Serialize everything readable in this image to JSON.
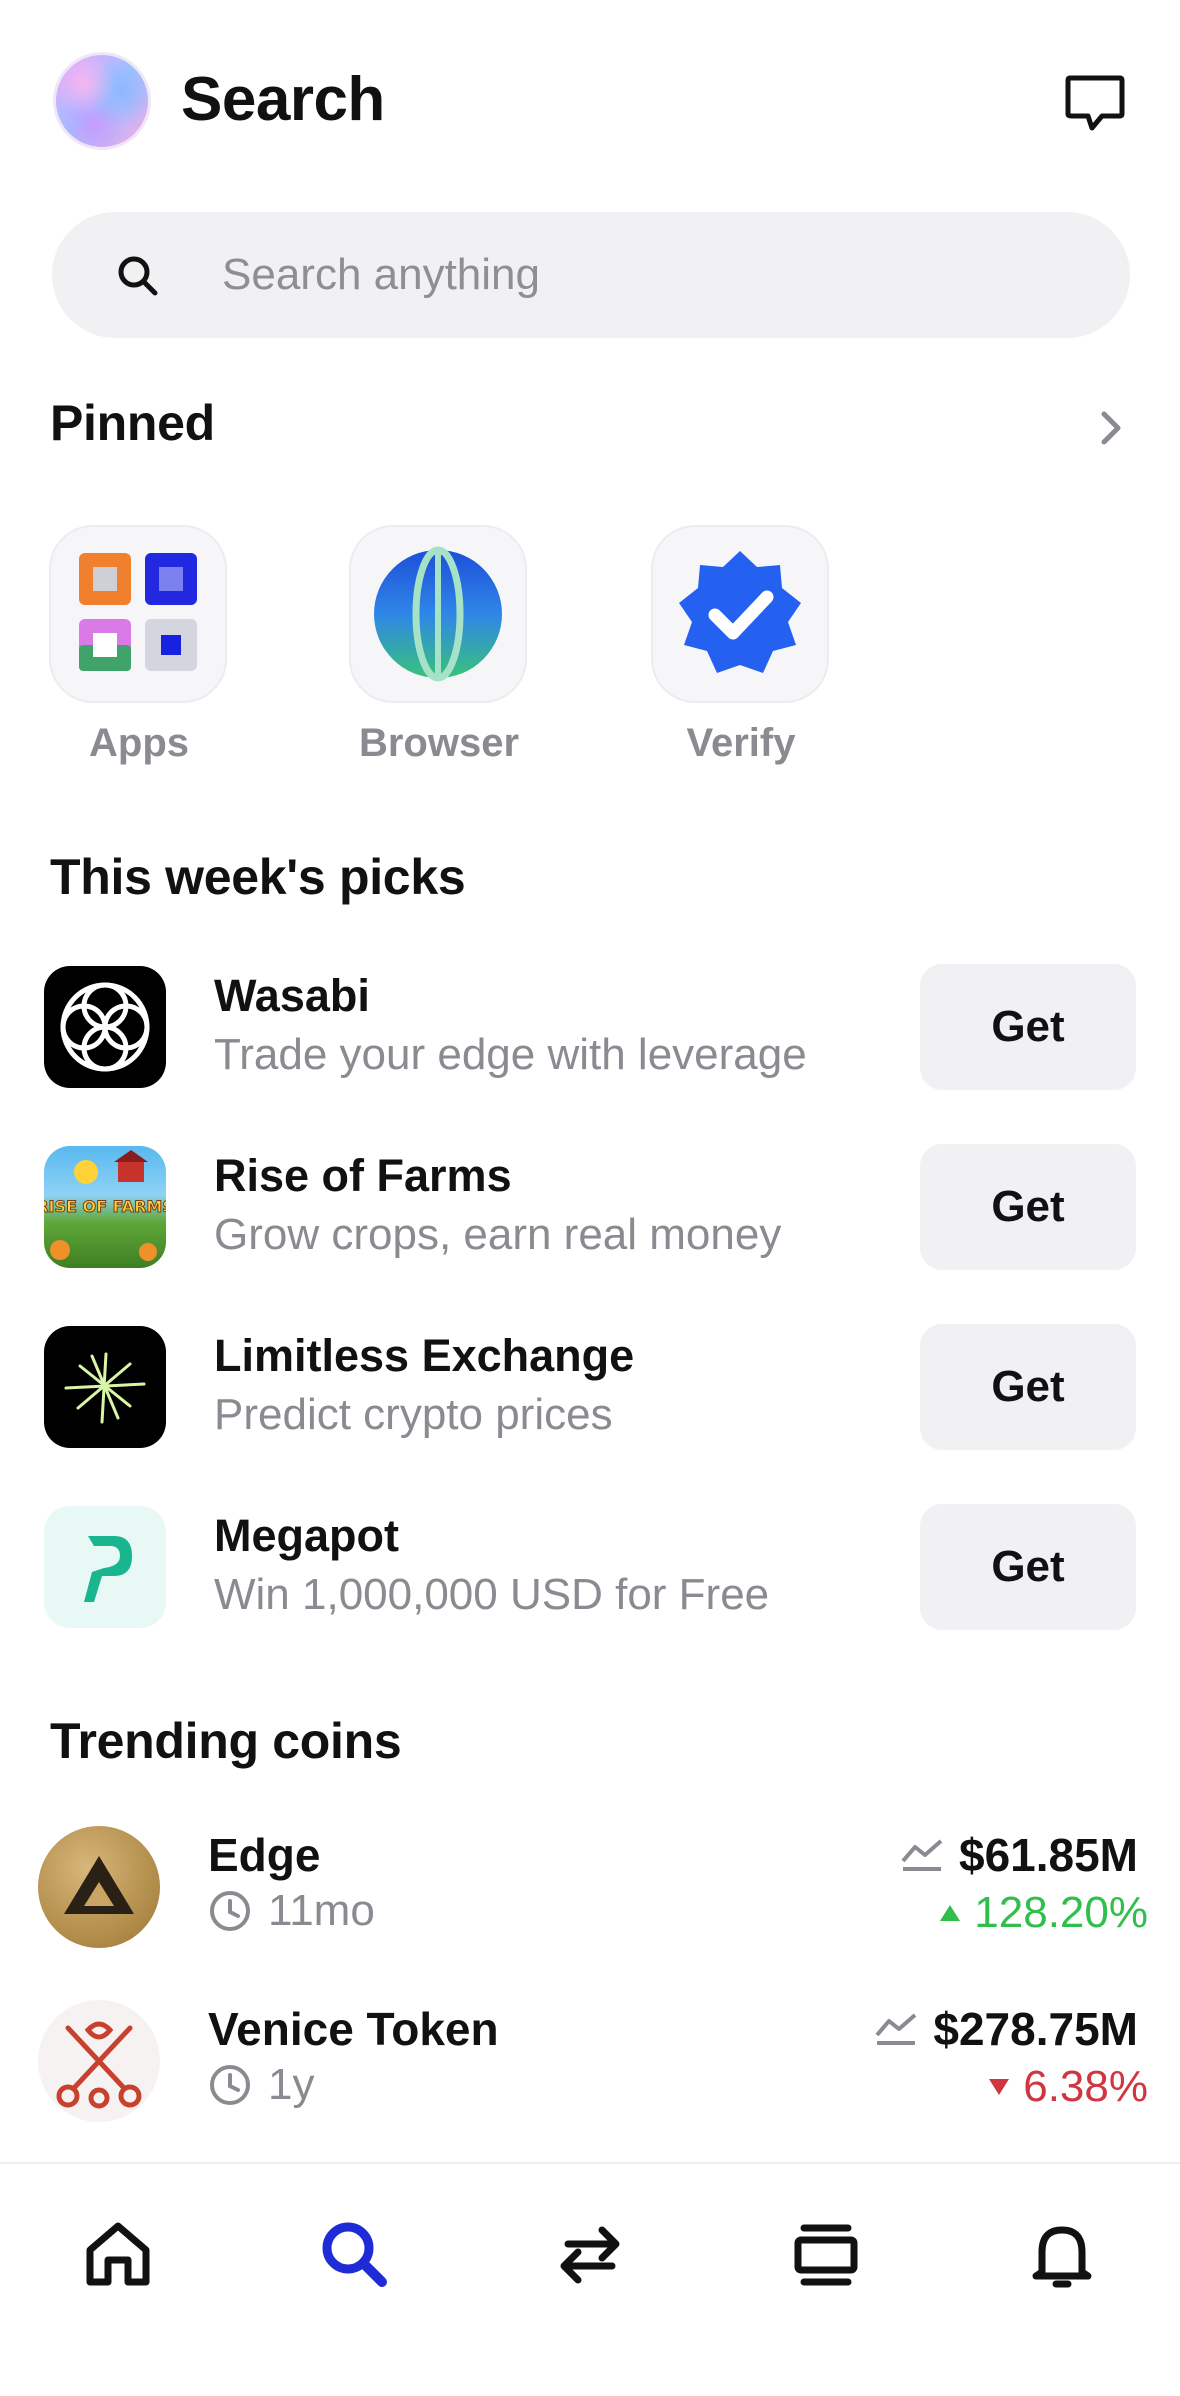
{
  "header": {
    "title": "Search",
    "avatar": "profile-avatar",
    "chat_icon": "chat-bubble-icon"
  },
  "search": {
    "placeholder": "Search anything",
    "value": ""
  },
  "pinned": {
    "title": "Pinned",
    "items": [
      {
        "label": "Apps",
        "icon": "apps-grid-icon"
      },
      {
        "label": "Browser",
        "icon": "globe-icon"
      },
      {
        "label": "Verify",
        "icon": "verified-badge-icon"
      }
    ]
  },
  "picks": {
    "title": "This week's picks",
    "items": [
      {
        "name": "Wasabi",
        "description": "Trade your edge with leverage",
        "button": "Get"
      },
      {
        "name": "Rise of Farms",
        "description": "Grow crops, earn real money",
        "button": "Get",
        "logo_text": "RISE OF FARMS"
      },
      {
        "name": "Limitless Exchange",
        "description": "Predict crypto prices",
        "button": "Get"
      },
      {
        "name": "Megapot",
        "description": "Win 1,000,000 USD for Free",
        "button": "Get"
      }
    ]
  },
  "trending": {
    "title": "Trending coins",
    "coins": [
      {
        "name": "Edge",
        "age": "11mo",
        "market_cap": "$61.85M",
        "change": "128.20%",
        "direction": "up"
      },
      {
        "name": "Venice Token",
        "age": "1y",
        "market_cap": "$278.75M",
        "change": "6.38%",
        "direction": "down"
      }
    ]
  },
  "colors": {
    "accent": "#1f2bd6",
    "positive": "#2fbf4a",
    "negative": "#d0363f",
    "muted_text": "#8a8a90",
    "surface": "#f1f1f4"
  },
  "tabbar": {
    "items": [
      {
        "icon": "home-icon",
        "active": false
      },
      {
        "icon": "search-icon",
        "active": true
      },
      {
        "icon": "swap-icon",
        "active": false
      },
      {
        "icon": "cards-icon",
        "active": false
      },
      {
        "icon": "bell-icon",
        "active": false
      }
    ]
  }
}
